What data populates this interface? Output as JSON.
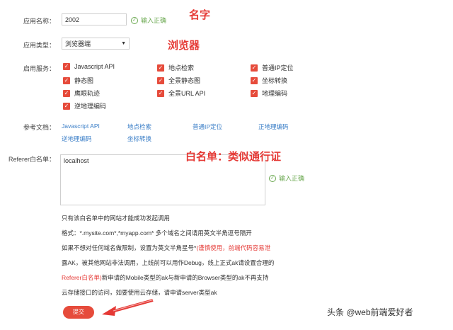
{
  "form": {
    "app_name_label": "应用名称：",
    "app_name_value": "2002",
    "app_name_status": "输入正确",
    "app_type_label": "应用类型：",
    "app_type_value": "浏览器端",
    "service_label": "启用服务：",
    "services": [
      {
        "label": "Javascript API",
        "checked": true
      },
      {
        "label": "地点检索",
        "checked": true
      },
      {
        "label": "普通IP定位",
        "checked": true
      },
      {
        "label": "静态图",
        "checked": true
      },
      {
        "label": "全景静态图",
        "checked": true
      },
      {
        "label": "坐标转换",
        "checked": true
      },
      {
        "label": "鹰眼轨迹",
        "checked": true
      },
      {
        "label": "全景URL API",
        "checked": true
      },
      {
        "label": "地理编码",
        "checked": true
      },
      {
        "label": "逆地理编码",
        "checked": true
      }
    ],
    "docs_label": "参考文档：",
    "docs": [
      "Javascript API",
      "地点检索",
      "普通IP定位",
      "正地理编码",
      "逆地理编码",
      "坐标转换"
    ],
    "referer_label": "Referer白名单：",
    "referer_value": "localhost",
    "referer_status": "输入正确",
    "notes": {
      "line1": "只有该白名单中的网站才能成功发起调用",
      "line2": "格式：*.mysite.com*,*myapp.com* 多个域名之间请用英文半角逗号隔开",
      "line3_a": "如果不想对任何域名做限制，设置为英文半角星号*",
      "line3_b": "(谨慎使用，前端代码容易泄",
      "line4": "露AK，被其他网站非法调用，上线前可以用作Debug，线上正式ak请设置合理的",
      "line5_a": "Referer白名单)",
      "line5_b": "新申请的Mobile类型的ak与新申请的Browser类型的ak不再支持",
      "line6": "云存储接口的访问，如要使用云存储，请申请server类型ak"
    },
    "submit_label": "提交"
  },
  "annotations": {
    "name": "名字",
    "browser": "浏览器",
    "whitelist": "白名单：类似通行证"
  },
  "watermark": "头条 @web前端爱好者",
  "colors": {
    "accent_red": "#e64b3b",
    "ok_green": "#6aa84f",
    "link_blue": "#3a7ec7"
  }
}
